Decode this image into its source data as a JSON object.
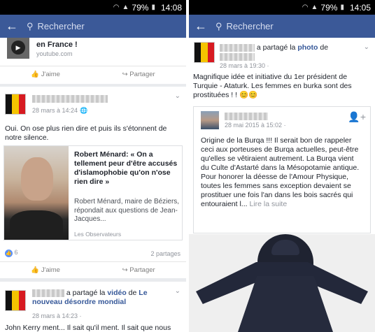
{
  "status": {
    "battery": "79%",
    "time_left": "14:08",
    "time_right": "14:05"
  },
  "nav": {
    "search_placeholder": "Rechercher"
  },
  "left": {
    "top_link": {
      "title": "en France !",
      "source": "youtube.com"
    },
    "like_label": "J'aime",
    "share_label": "Partager",
    "post2": {
      "time": "28 mars à 14:24 ·",
      "text": "Oui. On ose plus rien dire et puis ils s'étonnent de notre silence.",
      "article_title": "Robert Ménard: « On a tellement peur d'être accusés d'islamophobie qu'on n'ose rien dire »",
      "article_desc": "Robert Ménard, maire de Béziers, répondait aux questions de Jean-Jacques...",
      "article_source": "Les Observateurs",
      "likes_count": "6",
      "shares": "2 partages"
    },
    "post3": {
      "action": "a partagé la",
      "video_word": "vidéo",
      "de_word": "de",
      "page": "Le nouveau désordre mondial",
      "time": "28 mars à 14:23 ·",
      "text": "John Kerry ment... Il sait qu'il ment. Il sait que nous"
    }
  },
  "right": {
    "post": {
      "action": "a partagé la",
      "photo_word": "photo",
      "de_word": "de",
      "time": "28 mars à 19:30 ·",
      "text": "Magnifique idée et initiative du 1er président de Turquie - Ataturk. Les femmes en burka sont des prostituées ! !",
      "emoji": "😊😊"
    },
    "shared": {
      "time": "28 mai 2015 à 15:02 ·",
      "text": "Origine de la Burqa !!! Il serait bon de rappeler ceci aux porteuses de Burqa actuelles, peut-être qu'elles se vêtiraient autrement. La Burqa vient du Culte d'Astarté dans la Mésopotamie antique. Pour honorer la déesse de l'Amour Physique, toutes les femmes sans exception devaient se prostituer une fois l'an dans les bois sacrés qui entouraient l...",
      "read_more": "Lire la suite"
    }
  },
  "colors": {
    "fb_blue": "#3b5998",
    "link_blue": "#365899",
    "background": "#e9ebee"
  }
}
